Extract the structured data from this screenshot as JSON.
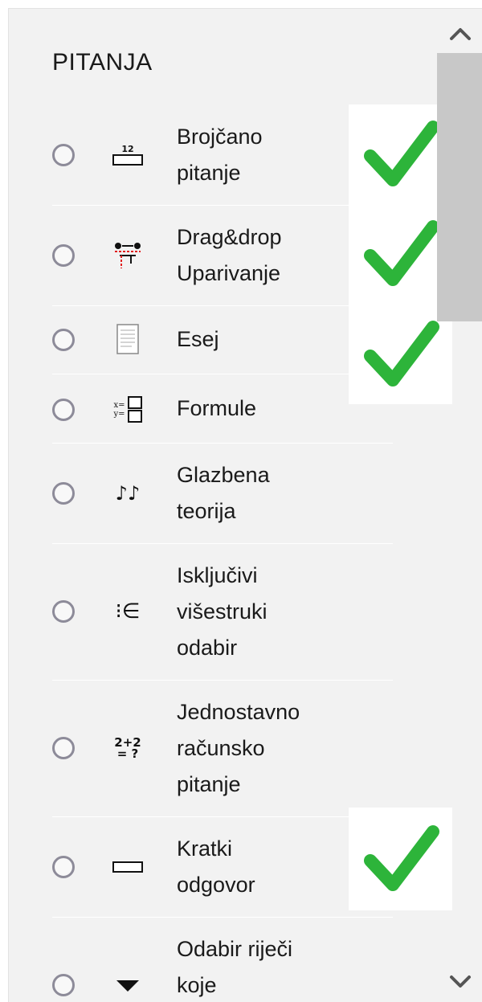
{
  "panel": {
    "title": "PITANJA"
  },
  "questions": [
    {
      "label": "Brojčano\npitanje",
      "icon": "numerical-question-icon",
      "icon_text": "12",
      "checked": true
    },
    {
      "label": "Drag&drop\nUparivanje",
      "icon": "drag-drop-matching-icon",
      "checked": true
    },
    {
      "label": "Esej",
      "icon": "essay-icon",
      "checked": true
    },
    {
      "label": "Formule",
      "icon": "formulas-icon",
      "icon_text": "x=\ny="
    },
    {
      "label": "Glazbena\nteorija",
      "icon": "music-theory-icon",
      "icon_text": "♪♪"
    },
    {
      "label": "Isključivi\nvišestruki\nodabir",
      "icon": "multichoice-icon",
      "icon_text": "⁝∈"
    },
    {
      "label": "Jednostavno\nračunsko\npitanje",
      "icon": "calculated-simple-icon",
      "icon_text": "2+2\n= ?"
    },
    {
      "label": "Kratki\nodgovor",
      "icon": "short-answer-icon",
      "checked": true
    },
    {
      "label": "Odabir riječi\nkoje",
      "icon": "select-missing-words-icon"
    }
  ],
  "colors": {
    "check": "#2db43a",
    "radio": "#8d8b99",
    "panel_bg": "#f2f2f2",
    "scroll_thumb": "#c8c8c8"
  },
  "scrollbar": {
    "up_icon": "chevron-up-icon",
    "down_icon": "chevron-down-icon"
  }
}
